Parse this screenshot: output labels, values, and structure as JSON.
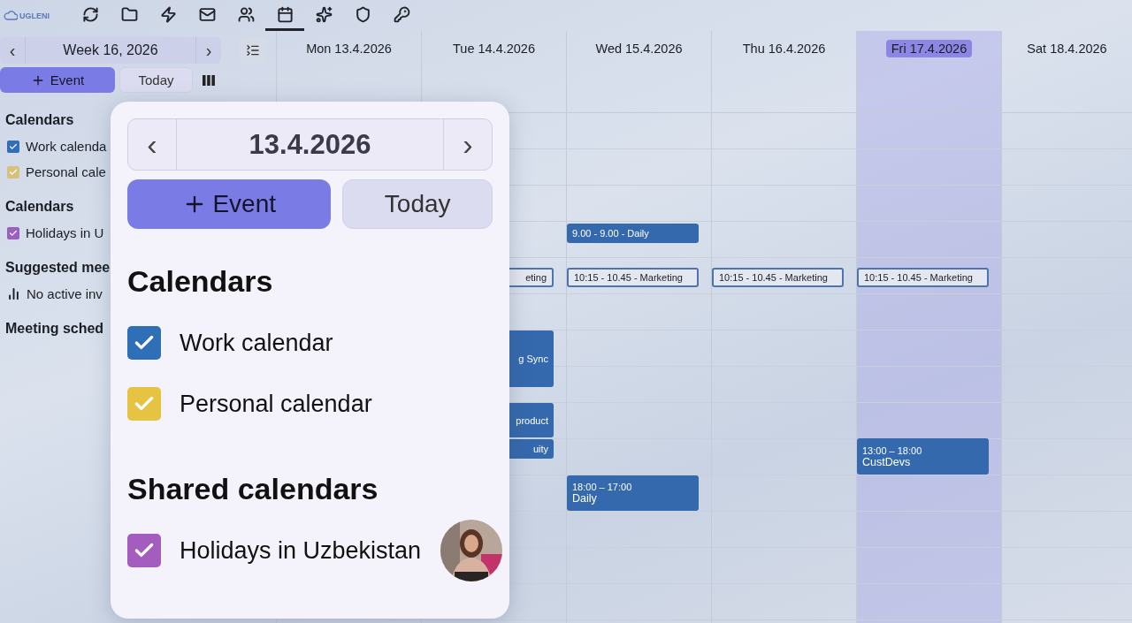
{
  "top_bar": {
    "logo": "UGLENI",
    "icons": [
      {
        "kind": "sync",
        "selected": false
      },
      {
        "kind": "folder",
        "selected": false
      },
      {
        "kind": "bolt",
        "selected": false
      },
      {
        "kind": "mail",
        "selected": false
      },
      {
        "kind": "people",
        "selected": false
      },
      {
        "kind": "calendar",
        "selected": true
      },
      {
        "kind": "sparkle",
        "selected": false
      },
      {
        "kind": "shield",
        "selected": false
      },
      {
        "kind": "key",
        "selected": false
      }
    ]
  },
  "sidebar": {
    "week": "Week 16, 2026",
    "prev": "‹",
    "next": "›",
    "new_event": "Event",
    "today": "Today",
    "sections": [
      {
        "title": "Calendars",
        "items": [
          {
            "label": "Work calenda",
            "checked": true,
            "color": "#2f6fb8"
          },
          {
            "label": "Personal cale",
            "checked": true,
            "color": "#d6c27e"
          }
        ]
      },
      {
        "title": "Calendars",
        "items": [
          {
            "label": "Holidays in U",
            "checked": true,
            "color": "#9b5fc0"
          }
        ]
      },
      {
        "title": "Suggested mee",
        "note": "No active inv"
      },
      {
        "title": "Meeting sched"
      }
    ]
  },
  "calendar": {
    "days": [
      {
        "label": "Mon 13.4.2026",
        "selected": false
      },
      {
        "label": "Tue 14.4.2026",
        "selected": false,
        "events": [
          {
            "kind": "outline",
            "title": "eting"
          },
          {
            "kind": "filled",
            "title": "g Sync"
          },
          {
            "kind": "filled",
            "title": "product"
          },
          {
            "kind": "filled",
            "title": "uity"
          }
        ]
      },
      {
        "label": "Wed 15.4.2026",
        "selected": false,
        "events": [
          {
            "kind": "filled",
            "title": "9.00 - 9.00 - Daily"
          },
          {
            "kind": "outline",
            "title": "10:15 - 10.45 - Marketing"
          },
          {
            "kind": "block",
            "time": "18:00 – 17:00",
            "title": "Daily"
          }
        ]
      },
      {
        "label": "Thu 16.4.2026",
        "selected": false,
        "events": [
          {
            "kind": "outline",
            "title": "10:15 - 10.45 - Marketing"
          }
        ]
      },
      {
        "label": "Fri 17.4.2026",
        "selected": true,
        "events": [
          {
            "kind": "outline",
            "title": "10:15 - 10.45 - Marketing"
          },
          {
            "kind": "block",
            "time": "13:00 – 18:00",
            "title": "CustDevs"
          }
        ]
      },
      {
        "label": "Sat 18.4.2026",
        "selected": false
      }
    ]
  },
  "popup": {
    "date": "13.4.2026",
    "prev": "‹",
    "next": "›",
    "new_event": "Event",
    "today": "Today",
    "sections": [
      {
        "title": "Calendars",
        "items": [
          {
            "label": "Work calendar",
            "checked": true,
            "color": "#2f6fb8"
          },
          {
            "label": "Personal calendar",
            "checked": true,
            "color": "#e6c343"
          }
        ]
      },
      {
        "title": "Shared calendars",
        "items": [
          {
            "label": "Holidays in Uzbekistan",
            "checked": true,
            "color": "#a45dbf",
            "avatar": true
          }
        ]
      }
    ]
  }
}
